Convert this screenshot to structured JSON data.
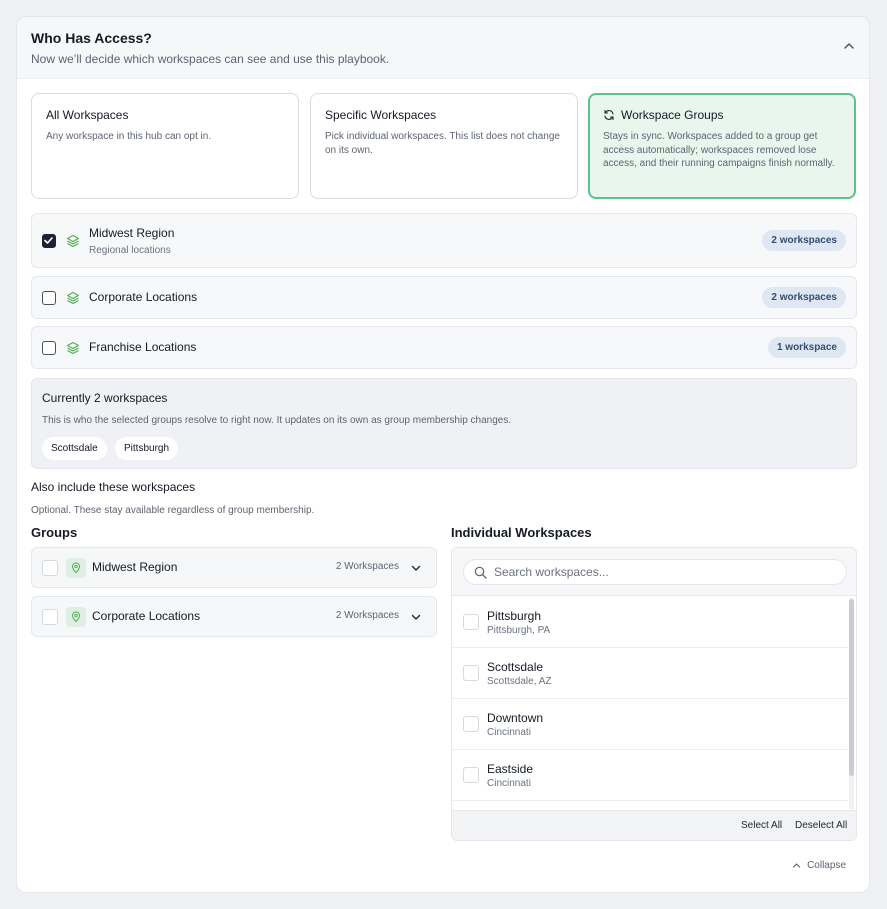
{
  "header": {
    "title": "Who Has Access?",
    "subtitle": "Now we’ll decide which workspaces can see and use this playbook."
  },
  "options": [
    {
      "title": "All Workspaces",
      "desc": "Any workspace in this hub can opt in.",
      "selected": false
    },
    {
      "title": "Specific Workspaces",
      "desc": "Pick individual workspaces. This list does not change on its own.",
      "selected": false
    },
    {
      "title": "Workspace Groups",
      "desc": "Stays in sync. Workspaces added to a group get access automatically; workspaces removed lose access, and their running campaigns finish normally.",
      "selected": true,
      "icon": "sync-icon"
    }
  ],
  "groups": [
    {
      "name": "Midwest Region",
      "sub": "Regional locations",
      "count": "2 workspaces",
      "checked": true
    },
    {
      "name": "Corporate Locations",
      "count": "2 workspaces",
      "checked": false
    },
    {
      "name": "Franchise Locations",
      "count": "1 workspace",
      "checked": false
    }
  ],
  "current": {
    "title": "Currently 2 workspaces",
    "desc": "This is who the selected groups resolve to right now. It updates on its own as group membership changes.",
    "chips": [
      "Scottsdale",
      "Pittsburgh"
    ]
  },
  "also": {
    "title": "Also include these workspaces",
    "desc": "Optional. These stay available regardless of group membership."
  },
  "groups_column": {
    "title": "Groups",
    "items": [
      {
        "name": "Midwest Region",
        "count": "2 Workspaces"
      },
      {
        "name": "Corporate Locations",
        "count": "2 Workspaces"
      }
    ]
  },
  "individual": {
    "title": "Individual Workspaces",
    "search_placeholder": "Search workspaces...",
    "items": [
      {
        "name": "Pittsburgh",
        "loc": "Pittsburgh, PA"
      },
      {
        "name": "Scottsdale",
        "loc": "Scottsdale, AZ"
      },
      {
        "name": "Downtown",
        "loc": "Cincinnati"
      },
      {
        "name": "Eastside",
        "loc": "Cincinnati"
      }
    ],
    "select_all": "Select All",
    "deselect_all": "Deselect All"
  },
  "collapse_label": "Collapse",
  "colors": {
    "accent_green": "#5bc48a",
    "selected_bg": "#e8f6ee",
    "pill_bg": "#dfe7f3",
    "icon_green": "#4caf50"
  }
}
